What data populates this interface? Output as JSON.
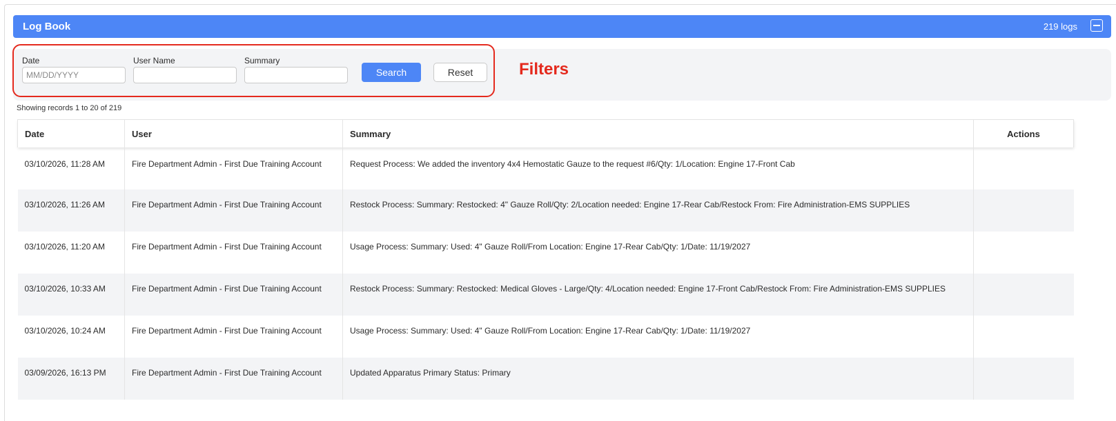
{
  "panel": {
    "title": "Log Book",
    "count": "219 logs"
  },
  "filters": {
    "date": {
      "label": "Date",
      "placeholder": "MM/DD/YYYY",
      "value": ""
    },
    "user_name": {
      "label": "User Name",
      "placeholder": "",
      "value": ""
    },
    "summary": {
      "label": "Summary",
      "placeholder": "",
      "value": ""
    },
    "search_label": "Search",
    "reset_label": "Reset",
    "annotation": "Filters"
  },
  "record_info": "Showing records 1 to 20 of 219",
  "table": {
    "headers": {
      "date": "Date",
      "user": "User",
      "summary": "Summary",
      "actions": "Actions"
    },
    "rows": [
      {
        "date": "03/10/2026, 11:28 AM",
        "user": "Fire Department Admin - First Due Training Account",
        "summary": "Request Process: We added the inventory 4x4 Hemostatic Gauze to the request #6/Qty: 1/Location: Engine 17-Front Cab"
      },
      {
        "date": "03/10/2026, 11:26 AM",
        "user": "Fire Department Admin - First Due Training Account",
        "summary": "Restock Process: Summary: Restocked: 4\" Gauze Roll/Qty: 2/Location needed: Engine 17-Rear Cab/Restock From: Fire Administration-EMS SUPPLIES"
      },
      {
        "date": "03/10/2026, 11:20 AM",
        "user": "Fire Department Admin - First Due Training Account",
        "summary": "Usage Process: Summary: Used: 4\" Gauze Roll/From Location: Engine 17-Rear Cab/Qty: 1/Date: 11/19/2027"
      },
      {
        "date": "03/10/2026, 10:33 AM",
        "user": "Fire Department Admin - First Due Training Account",
        "summary": "Restock Process: Summary: Restocked: Medical Gloves - Large/Qty: 4/Location needed: Engine 17-Front Cab/Restock From: Fire Administration-EMS SUPPLIES"
      },
      {
        "date": "03/10/2026, 10:24 AM",
        "user": "Fire Department Admin - First Due Training Account",
        "summary": "Usage Process: Summary: Used: 4\" Gauze Roll/From Location: Engine 17-Rear Cab/Qty: 1/Date: 11/19/2027"
      },
      {
        "date": "03/09/2026, 16:13 PM",
        "user": "Fire Department Admin - First Due Training Account",
        "summary": "Updated Apparatus Primary Status: Primary"
      }
    ]
  },
  "colors": {
    "accent": "#4d86f6",
    "annotation": "#e4291d",
    "stripe": "#f3f4f6"
  }
}
